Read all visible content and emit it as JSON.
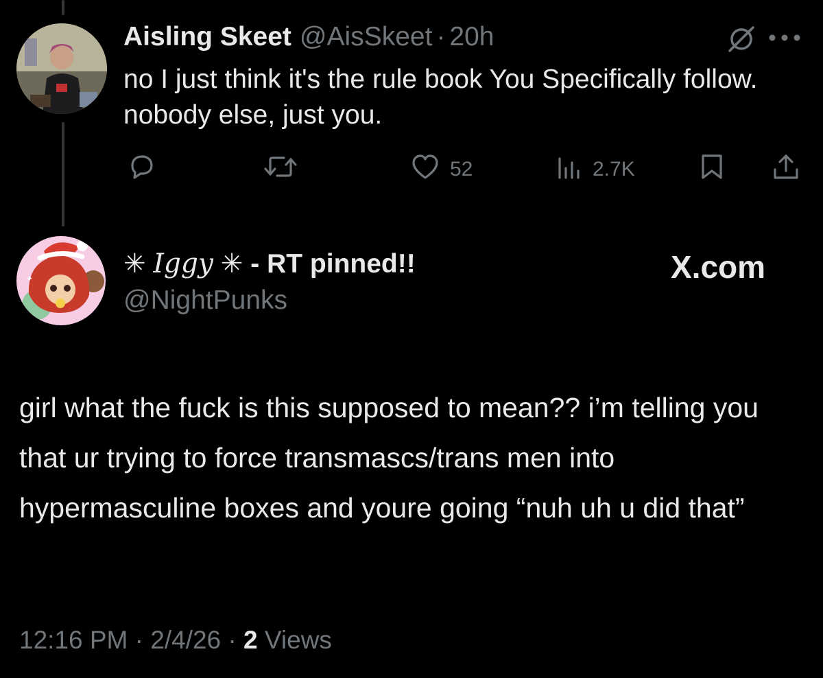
{
  "parent_tweet": {
    "display_name": "Aisling Skeet",
    "handle": "@AisSkeet",
    "separator": "·",
    "time_ago": "20h",
    "text": "no I just think it's the rule book You Specifically follow. nobody else, just you.",
    "likes": "52",
    "views": "2.7K",
    "icons": [
      "grok-icon",
      "more-icon",
      "reply-icon",
      "retweet-icon",
      "like-icon",
      "views-icon",
      "bookmark-icon",
      "share-icon"
    ]
  },
  "reply_card": {
    "name_decor_left": "✳",
    "name_script": "Iggy",
    "name_decor_right": "✳",
    "name_suffix": " - RT pinned!!",
    "handle": "@NightPunks",
    "brand": "X.com",
    "text": "girl what the fuck is this supposed to mean?? i’m telling you that ur trying to force transmascs/trans men into hypermasculine boxes and youre going “nuh uh u did that”",
    "time": "12:16 PM",
    "separator": "·",
    "date": "2/4/26",
    "views_count": "2",
    "views_label": "Views"
  },
  "colors": {
    "background": "#000000",
    "primary_text": "#e7e9ea",
    "secondary_text": "#71767b",
    "thread_line": "#333639"
  }
}
